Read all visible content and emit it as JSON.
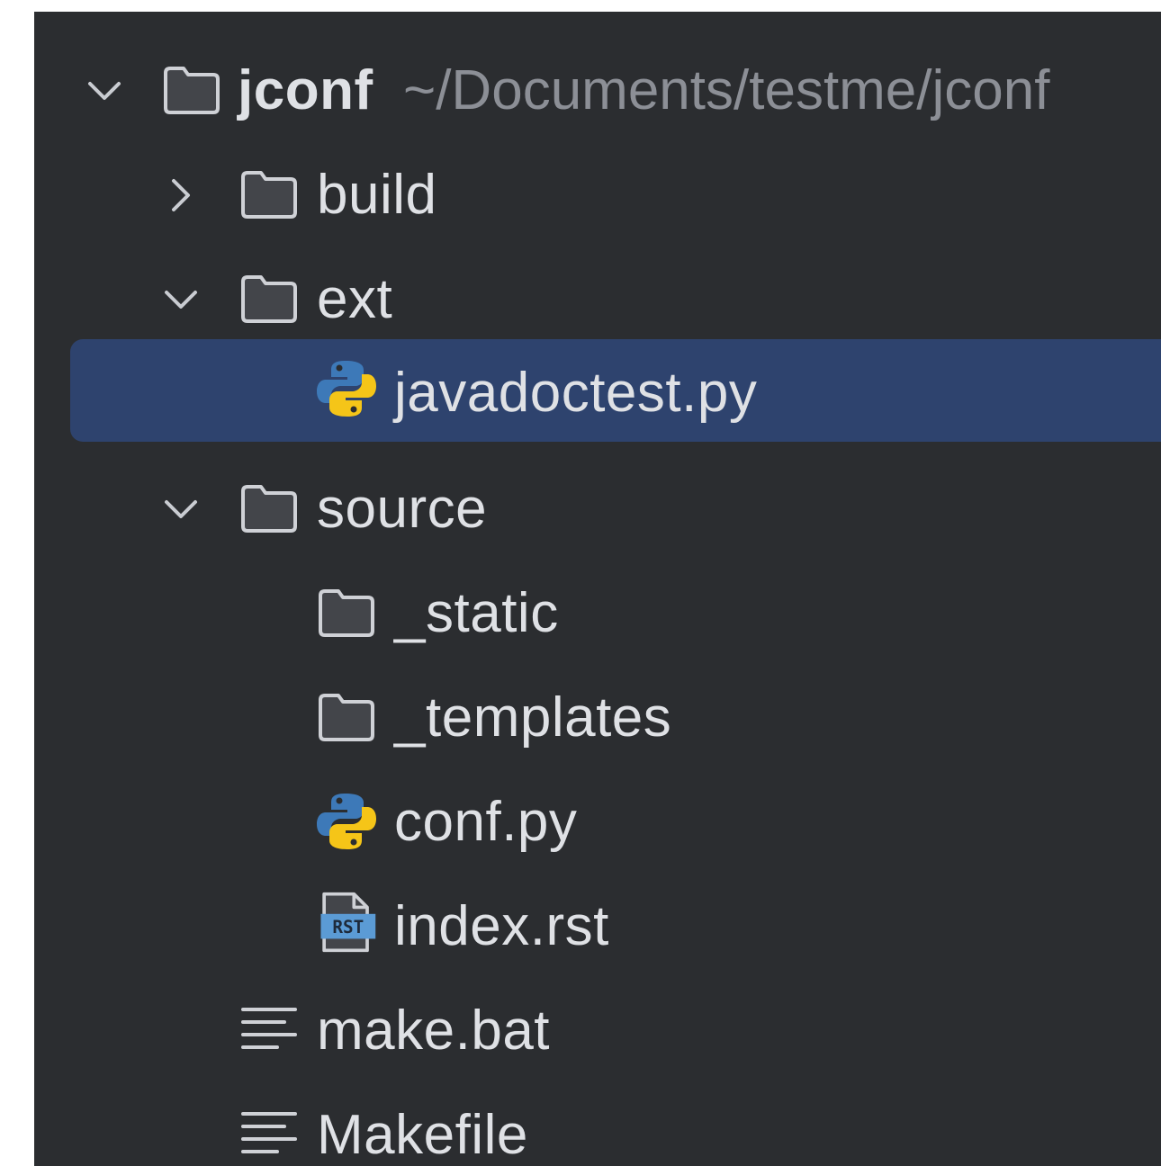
{
  "tree": {
    "root": {
      "name": "jconf",
      "path": "~/Documents/testme/jconf",
      "expanded": true,
      "icon": "folder-icon"
    },
    "items": [
      {
        "name": "build",
        "type": "folder",
        "expanded": false,
        "icon": "folder-icon"
      },
      {
        "name": "ext",
        "type": "folder",
        "expanded": true,
        "icon": "folder-icon"
      },
      {
        "name": "javadoctest.py",
        "type": "python-file",
        "selected": true,
        "icon": "python-icon"
      },
      {
        "name": "source",
        "type": "folder",
        "expanded": true,
        "icon": "folder-icon"
      },
      {
        "name": "_static",
        "type": "folder",
        "icon": "folder-icon"
      },
      {
        "name": "_templates",
        "type": "folder",
        "icon": "folder-icon"
      },
      {
        "name": "conf.py",
        "type": "python-file",
        "icon": "python-icon"
      },
      {
        "name": "index.rst",
        "type": "rst-file",
        "icon": "rst-file-icon",
        "icon_text": "RST"
      },
      {
        "name": "make.bat",
        "type": "text-file",
        "icon": "text-file-icon"
      },
      {
        "name": "Makefile",
        "type": "text-file",
        "icon": "text-file-icon"
      }
    ]
  },
  "colors": {
    "background": "#2b2d30",
    "selection": "#2e436e",
    "text": "#dfe1e5",
    "path_text": "#8c8f96",
    "folder_stroke": "#cfd1d6",
    "python_blue": "#3d79b8",
    "python_yellow": "#f5c518",
    "rst_badge": "#5b9bd5"
  }
}
